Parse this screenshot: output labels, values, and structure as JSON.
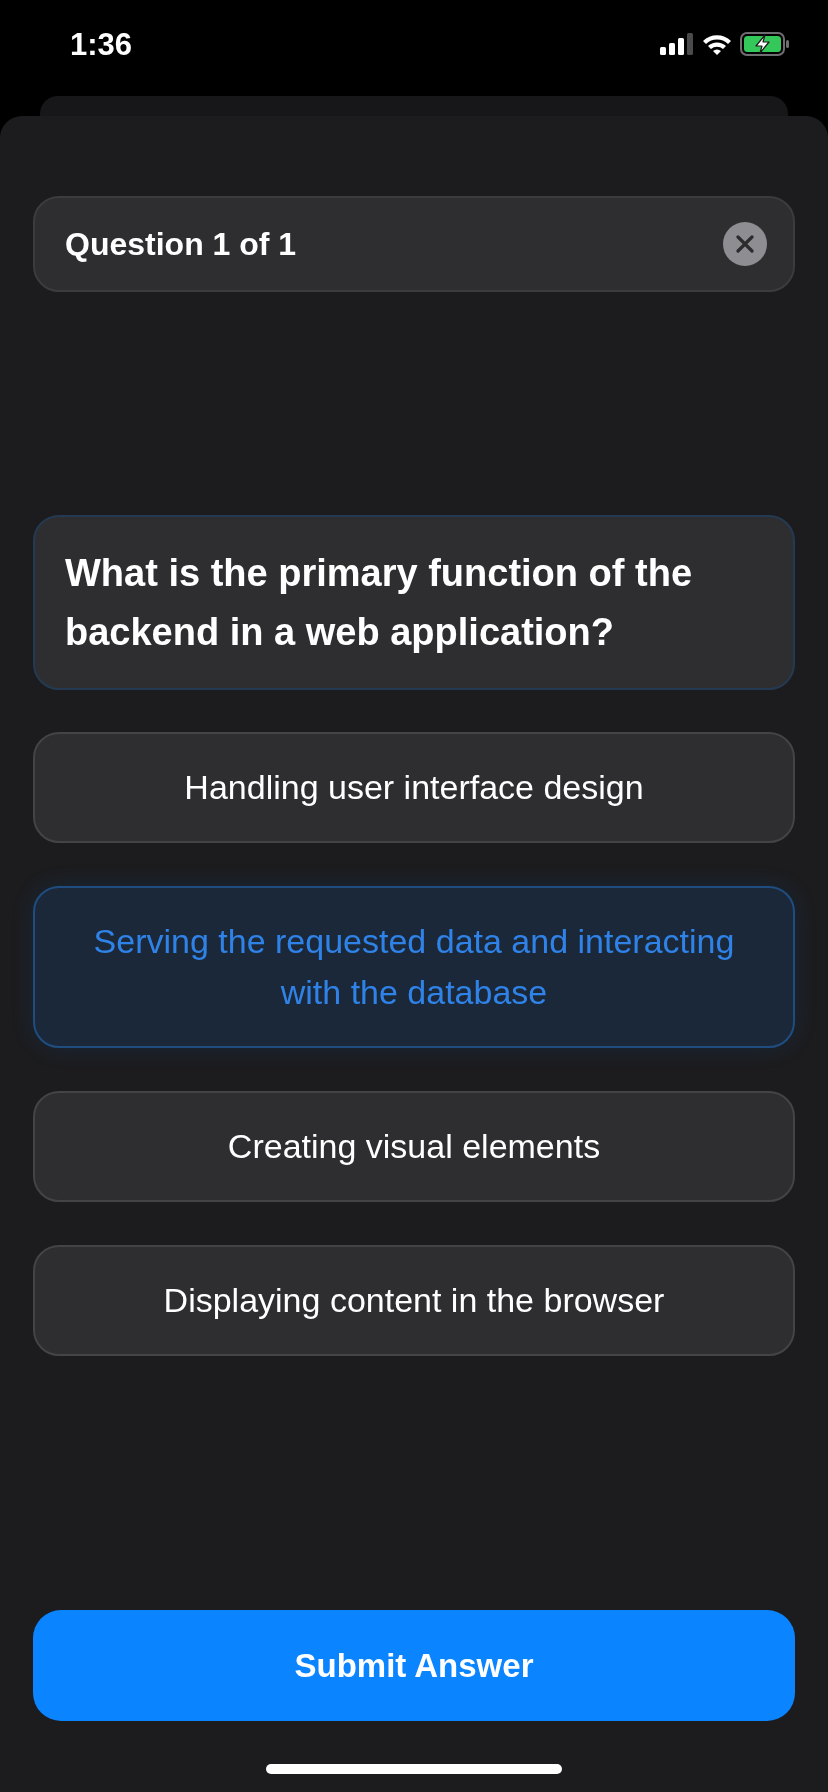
{
  "status_bar": {
    "time": "1:36"
  },
  "header": {
    "title": "Question 1 of 1"
  },
  "question": {
    "text": "What is the primary function of the backend in a web application?"
  },
  "options": [
    {
      "label": "Handling user interface design",
      "selected": false
    },
    {
      "label": "Serving the requested data and interacting with the database",
      "selected": true
    },
    {
      "label": "Creating visual elements",
      "selected": false
    },
    {
      "label": "Displaying content in the browser",
      "selected": false
    }
  ],
  "submit_button": {
    "label": "Submit Answer"
  }
}
